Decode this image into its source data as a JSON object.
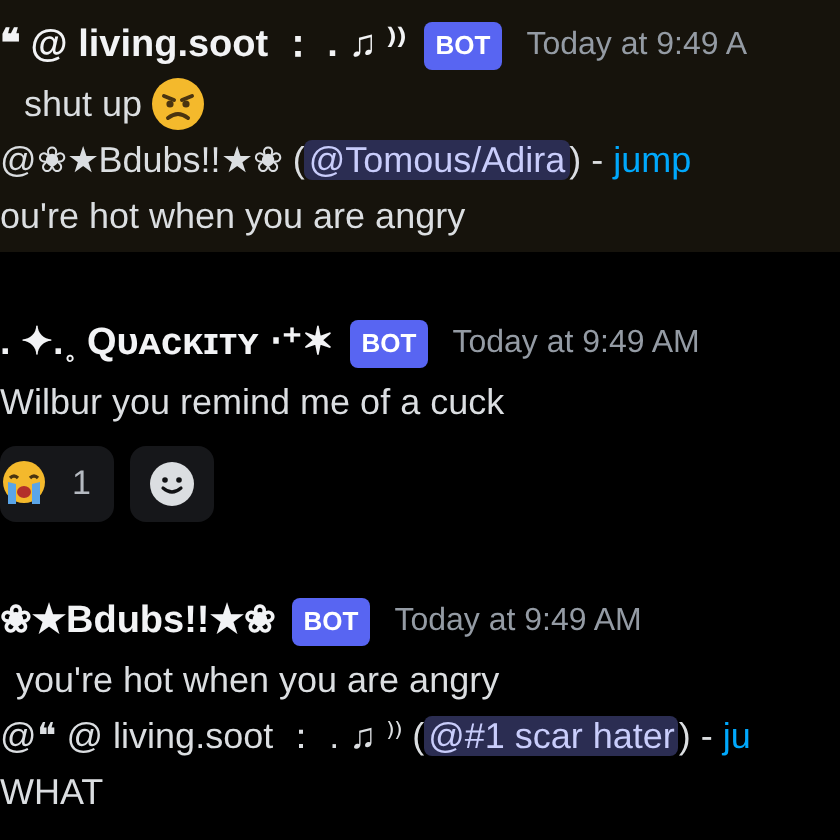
{
  "messages": [
    {
      "author": "❝ @ living.soot ： . ♫ ⁾⁾",
      "badge": "BOT",
      "timestamp": "Today at 9:49 A",
      "highlighted": true,
      "lines": [
        {
          "kind": "emoji_text",
          "text": "shut up"
        },
        {
          "kind": "reply",
          "author": "@❀★Bdubs!!★❀ (",
          "mention": "@Tomous/Adira",
          "after": ") - ",
          "link": "jump"
        },
        {
          "kind": "plain",
          "text": "ou're hot when you are angry"
        }
      ]
    },
    {
      "author": ". ✦.˳ Qᴜᴀᴄᴋɪᴛʏ ⋅⁺✶",
      "badge": "BOT",
      "timestamp": "Today at 9:49 AM",
      "highlighted": false,
      "lines": [
        {
          "kind": "plain",
          "text": "Wilbur you remind me of a cuck"
        }
      ],
      "reactions": [
        {
          "kind": "emoji",
          "count": "1"
        },
        {
          "kind": "add"
        }
      ]
    },
    {
      "author": "❀★Bdubs!!★❀",
      "badge": "BOT",
      "timestamp": "Today at 9:49 AM",
      "highlighted": false,
      "lines": [
        {
          "kind": "text",
          "text": "you're hot when you are angry"
        },
        {
          "kind": "reply",
          "author": "@❝  @  living.soot  ：  .  ♫ ⁾⁾ (",
          "mention": "@#1 scar hater",
          "after": ") - ",
          "link": "ju"
        },
        {
          "kind": "plain",
          "text": "WHAT"
        }
      ]
    }
  ]
}
